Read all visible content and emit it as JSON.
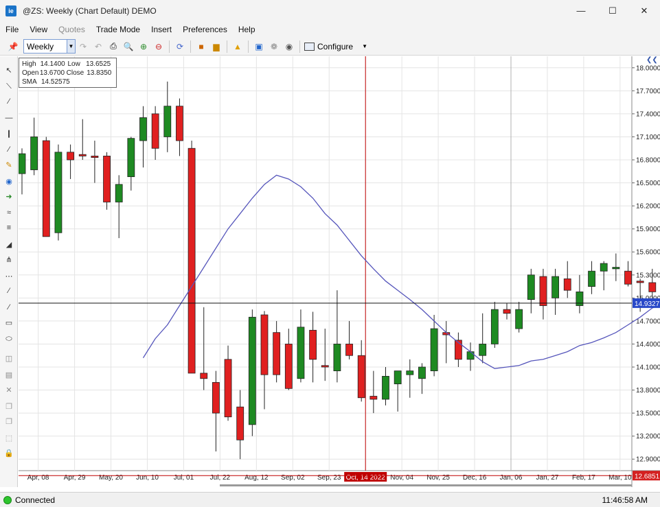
{
  "window": {
    "title": "@ZS: Weekly (Chart Default) DEMO",
    "app_icon": "ie"
  },
  "menu": [
    "File",
    "View",
    "Quotes",
    "Trade Mode",
    "Insert",
    "Preferences",
    "Help"
  ],
  "menu_disabled": [
    "Quotes"
  ],
  "toolbar": {
    "period": "Weekly",
    "configure_label": "Configure"
  },
  "infobox": {
    "high_label": "High",
    "high": "14.1400",
    "low_label": "Low",
    "low": "13.6525",
    "open_label": "Open",
    "open": "13.6700",
    "close_label": "Close",
    "close": "13.8350",
    "sma_label": "SMA",
    "sma": "14.52575"
  },
  "status": {
    "text": "Connected",
    "time": "11:46:58 AM"
  },
  "colors": {
    "up": "#1e8a22",
    "down": "#e02020",
    "sma": "#5555bb",
    "crosshair": "#c00000",
    "last_price_bg": "#2848c8",
    "low_marker_bg": "#d42020"
  },
  "chart_data": {
    "type": "candlestick",
    "ylim": [
      12.75,
      18.15
    ],
    "yticks": [
      "18.0000",
      "17.7000",
      "17.4000",
      "17.1000",
      "16.8000",
      "16.5000",
      "16.2000",
      "15.9000",
      "15.6000",
      "15.3000",
      "15.0000",
      "14.7000",
      "14.4000",
      "14.1000",
      "13.8000",
      "13.5000",
      "13.2000",
      "12.9000"
    ],
    "xticks": [
      "Apr, 08",
      "Apr, 29",
      "May, 20",
      "Jun, 10",
      "Jul, 01",
      "Jul, 22",
      "Aug, 12",
      "Sep, 02",
      "Sep, 23",
      "Oct, 14 2022",
      "Nov, 04",
      "Nov, 25",
      "Dec, 16",
      "Jan, 06",
      "Jan, 27",
      "Feb, 17",
      "Mar, 10"
    ],
    "cursor_label": "Oct, 14 2022",
    "last_price": "14.9327",
    "low_marker": "12.6851",
    "candles": [
      {
        "o": 16.62,
        "h": 16.95,
        "l": 16.35,
        "c": 16.88
      },
      {
        "o": 16.67,
        "h": 17.35,
        "l": 16.6,
        "c": 17.1
      },
      {
        "o": 17.05,
        "h": 17.1,
        "l": 15.8,
        "c": 15.8
      },
      {
        "o": 15.85,
        "h": 17.0,
        "l": 15.75,
        "c": 16.9
      },
      {
        "o": 16.9,
        "h": 17.0,
        "l": 16.55,
        "c": 16.8
      },
      {
        "o": 16.87,
        "h": 17.33,
        "l": 16.8,
        "c": 16.85
      },
      {
        "o": 16.85,
        "h": 17.05,
        "l": 16.5,
        "c": 16.83
      },
      {
        "o": 16.85,
        "h": 16.9,
        "l": 16.15,
        "c": 16.25
      },
      {
        "o": 16.25,
        "h": 16.6,
        "l": 15.78,
        "c": 16.48
      },
      {
        "o": 16.58,
        "h": 17.1,
        "l": 16.4,
        "c": 17.08
      },
      {
        "o": 17.05,
        "h": 17.5,
        "l": 16.7,
        "c": 17.35
      },
      {
        "o": 17.4,
        "h": 17.5,
        "l": 16.8,
        "c": 16.95
      },
      {
        "o": 17.1,
        "h": 17.82,
        "l": 16.9,
        "c": 17.5
      },
      {
        "o": 17.5,
        "h": 17.6,
        "l": 16.85,
        "c": 17.05
      },
      {
        "o": 16.95,
        "h": 17.05,
        "l": 14.02,
        "c": 14.02
      },
      {
        "o": 14.02,
        "h": 14.88,
        "l": 13.8,
        "c": 13.95
      },
      {
        "o": 13.9,
        "h": 14.05,
        "l": 13.0,
        "c": 13.5
      },
      {
        "o": 14.2,
        "h": 14.38,
        "l": 13.4,
        "c": 13.45
      },
      {
        "o": 13.58,
        "h": 13.8,
        "l": 12.9,
        "c": 13.15
      },
      {
        "o": 13.35,
        "h": 14.85,
        "l": 13.2,
        "c": 14.75
      },
      {
        "o": 14.78,
        "h": 14.83,
        "l": 13.55,
        "c": 14.0
      },
      {
        "o": 14.55,
        "h": 14.7,
        "l": 13.9,
        "c": 14.0
      },
      {
        "o": 14.4,
        "h": 14.6,
        "l": 13.8,
        "c": 13.82
      },
      {
        "o": 13.95,
        "h": 14.85,
        "l": 13.9,
        "c": 14.62
      },
      {
        "o": 14.58,
        "h": 14.82,
        "l": 13.9,
        "c": 14.2
      },
      {
        "o": 14.12,
        "h": 14.6,
        "l": 13.92,
        "c": 14.1
      },
      {
        "o": 14.05,
        "h": 15.1,
        "l": 13.9,
        "c": 14.4
      },
      {
        "o": 14.4,
        "h": 14.7,
        "l": 14.2,
        "c": 14.25
      },
      {
        "o": 14.25,
        "h": 14.45,
        "l": 13.65,
        "c": 13.7
      },
      {
        "o": 13.72,
        "h": 14.05,
        "l": 13.5,
        "c": 13.68
      },
      {
        "o": 13.68,
        "h": 14.1,
        "l": 13.6,
        "c": 13.98
      },
      {
        "o": 13.88,
        "h": 14.02,
        "l": 13.52,
        "c": 14.05
      },
      {
        "o": 14.0,
        "h": 14.2,
        "l": 13.7,
        "c": 14.05
      },
      {
        "o": 13.95,
        "h": 14.15,
        "l": 13.75,
        "c": 14.1
      },
      {
        "o": 14.05,
        "h": 14.78,
        "l": 13.98,
        "c": 14.6
      },
      {
        "o": 14.55,
        "h": 14.7,
        "l": 14.15,
        "c": 14.52
      },
      {
        "o": 14.45,
        "h": 14.55,
        "l": 14.1,
        "c": 14.2
      },
      {
        "o": 14.2,
        "h": 14.42,
        "l": 14.05,
        "c": 14.3
      },
      {
        "o": 14.25,
        "h": 14.8,
        "l": 14.15,
        "c": 14.4
      },
      {
        "o": 14.4,
        "h": 14.95,
        "l": 14.35,
        "c": 14.85
      },
      {
        "o": 14.85,
        "h": 14.93,
        "l": 14.72,
        "c": 14.8
      },
      {
        "o": 14.6,
        "h": 14.95,
        "l": 14.55,
        "c": 14.85
      },
      {
        "o": 14.98,
        "h": 15.38,
        "l": 14.8,
        "c": 15.3
      },
      {
        "o": 15.28,
        "h": 15.38,
        "l": 14.72,
        "c": 14.9
      },
      {
        "o": 15.0,
        "h": 15.38,
        "l": 14.78,
        "c": 15.28
      },
      {
        "o": 15.25,
        "h": 15.48,
        "l": 15.0,
        "c": 15.1
      },
      {
        "o": 14.9,
        "h": 15.3,
        "l": 14.8,
        "c": 15.08
      },
      {
        "o": 15.15,
        "h": 15.48,
        "l": 15.05,
        "c": 15.35
      },
      {
        "o": 15.35,
        "h": 15.48,
        "l": 15.1,
        "c": 15.45
      },
      {
        "o": 15.38,
        "h": 15.58,
        "l": 15.22,
        "c": 15.4
      },
      {
        "o": 15.35,
        "h": 15.48,
        "l": 15.15,
        "c": 15.18
      },
      {
        "o": 15.22,
        "h": 15.25,
        "l": 14.82,
        "c": 15.2
      },
      {
        "o": 15.2,
        "h": 15.38,
        "l": 14.92,
        "c": 15.08
      },
      {
        "o": 15.15,
        "h": 15.18,
        "l": 14.82,
        "c": 14.9
      }
    ],
    "sma_line": [
      14.22,
      14.47,
      14.65,
      14.9,
      15.15,
      15.4,
      15.65,
      15.9,
      16.1,
      16.3,
      16.48,
      16.6,
      16.55,
      16.45,
      16.3,
      16.1,
      15.95,
      15.75,
      15.55,
      15.38,
      15.22,
      15.1,
      14.98,
      14.85,
      14.7,
      14.55,
      14.42,
      14.3,
      14.17,
      14.08,
      14.1,
      14.12,
      14.18,
      14.2,
      14.25,
      14.3,
      14.38,
      14.42,
      14.48,
      14.55,
      14.65,
      14.75,
      14.87,
      14.93
    ]
  }
}
